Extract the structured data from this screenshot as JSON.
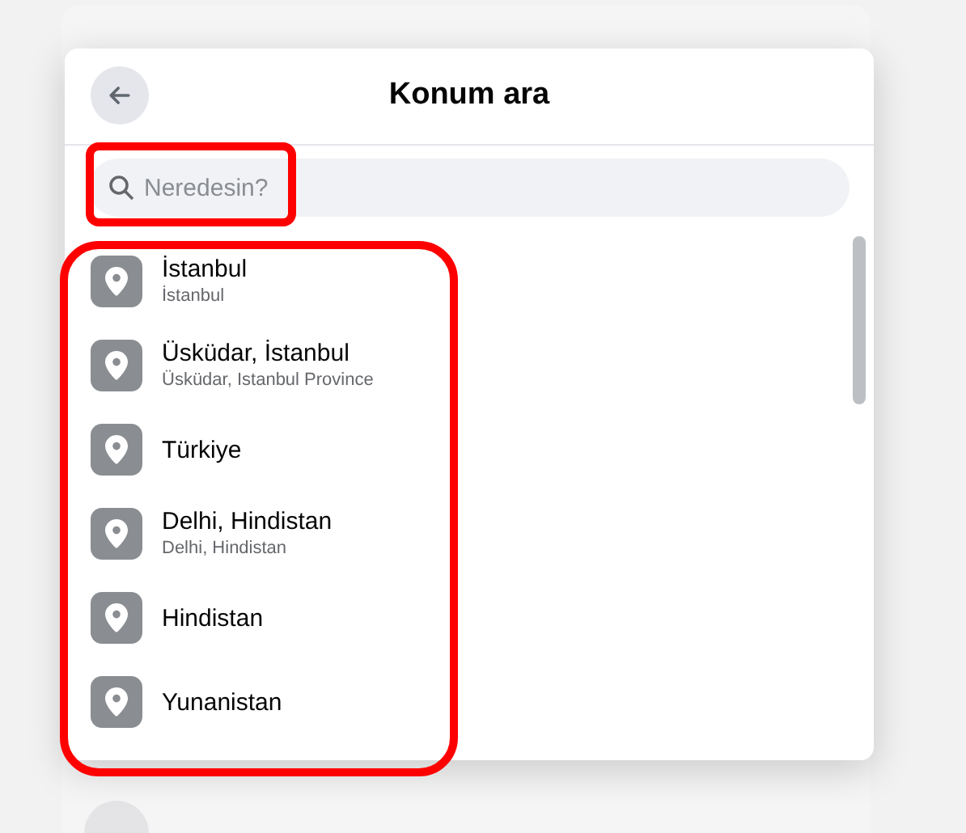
{
  "dialog": {
    "title": "Konum ara"
  },
  "search": {
    "placeholder": "Neredesin?"
  },
  "results": [
    {
      "name": "İstanbul",
      "detail": "İstanbul"
    },
    {
      "name": "Üsküdar, İstanbul",
      "detail": "Üsküdar, Istanbul Province"
    },
    {
      "name": "Türkiye"
    },
    {
      "name": "Delhi, Hindistan",
      "detail": "Delhi, Hindistan"
    },
    {
      "name": "Hindistan"
    },
    {
      "name": "Yunanistan"
    }
  ]
}
